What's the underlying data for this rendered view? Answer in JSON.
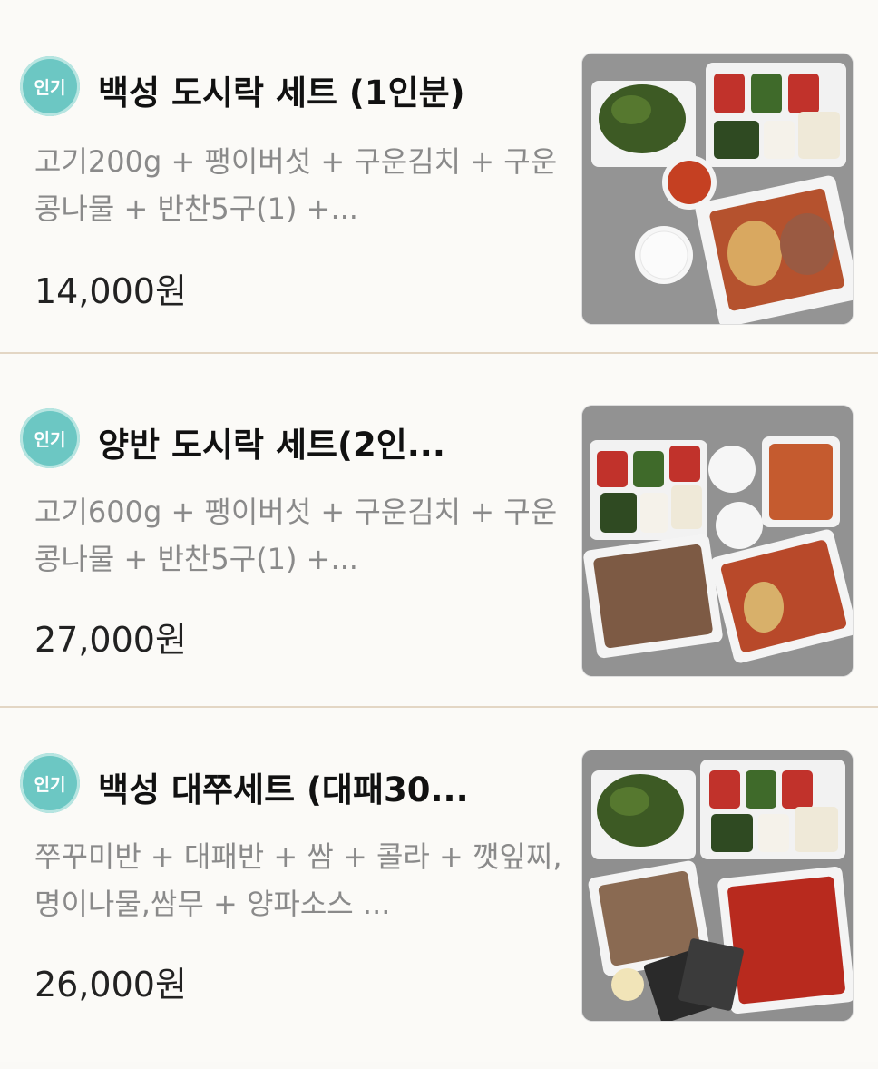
{
  "menu_items": [
    {
      "badge": "인기",
      "title": "백성 도시락 세트 (1인분)",
      "description": "고기200g + 팽이버섯 + 구운김치 + 구운콩나물 + 반찬5구(1) +...",
      "price": "14,000원"
    },
    {
      "badge": "인기",
      "title": "양반 도시락 세트(2인...",
      "description": "고기600g + 팽이버섯 + 구운김치 + 구운콩나물 + 반찬5구(1) +...",
      "price": "27,000원"
    },
    {
      "badge": "인기",
      "title": "백성 대쭈세트 (대패30...",
      "description": "쭈꾸미반 + 대패반 + 쌈 + 콜라 + 깻잎찌,명이나물,쌈무 + 양파소스 ...",
      "price": "26,000원"
    }
  ]
}
